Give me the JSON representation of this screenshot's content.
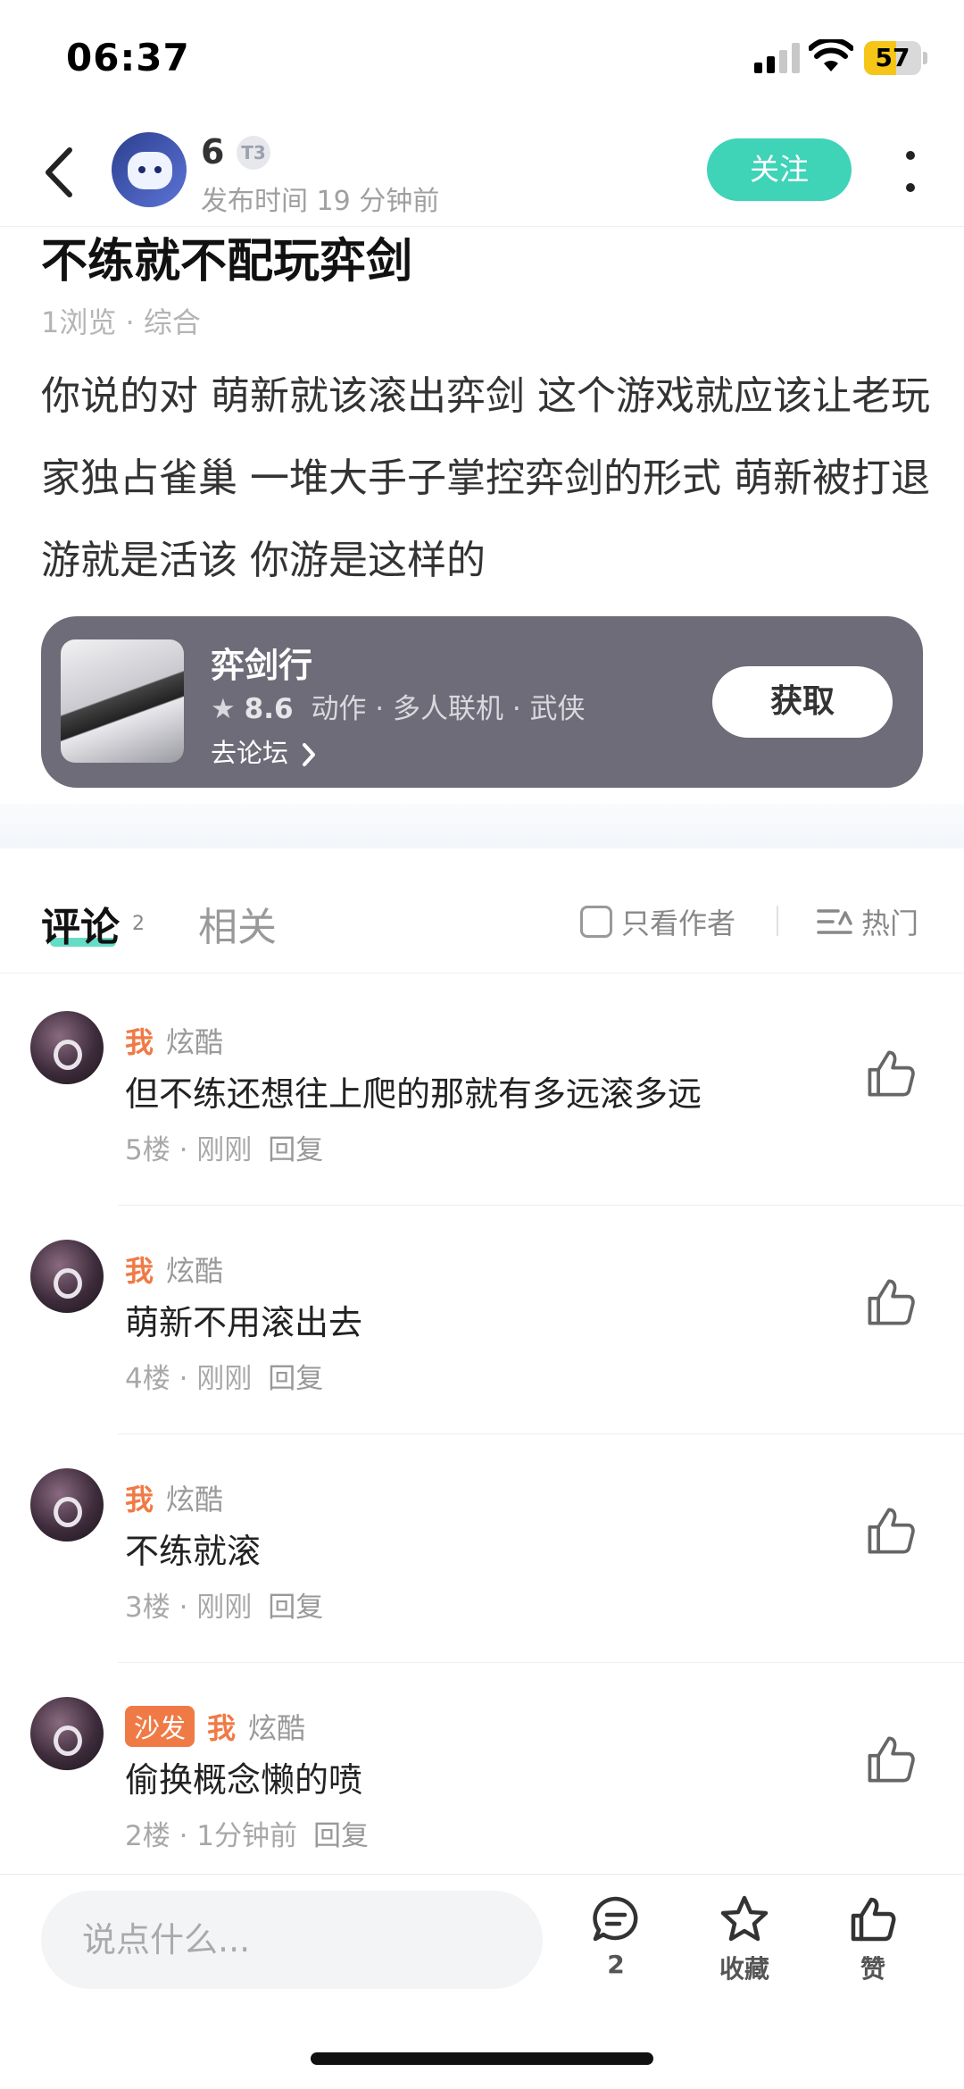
{
  "status_bar": {
    "time": "06:37",
    "battery": "57",
    "battery_level": 0.57
  },
  "header": {
    "author_name": "6",
    "level_badge": "T3",
    "publish_time": "发布时间 19 分钟前",
    "follow_label": "关注"
  },
  "post": {
    "title": "不练就不配玩弈剑",
    "meta": "1浏览 · 综合",
    "body": "你说的对 萌新就该滚出弈剑 这个游戏就应该让老玩家独占雀巢 一堆大手子掌控弈剑的形式 萌新被打退游就是活该 你游是这样的"
  },
  "game_card": {
    "name": "弈剑行",
    "rating": "8.6",
    "tags": "动作 · 多人联机 · 武侠",
    "forum_link": "去论坛",
    "get_label": "获取"
  },
  "tabs": {
    "comments_label": "评论",
    "comments_count": "2",
    "related_label": "相关",
    "author_only_label": "只看作者",
    "sort_label": "热门"
  },
  "comments": [
    {
      "tag": "",
      "me": "我",
      "user": "炫酷",
      "text": "但不练还想往上爬的那就有多远滚多远",
      "meta": "5楼 · 刚刚",
      "reply": "回复"
    },
    {
      "tag": "",
      "me": "我",
      "user": "炫酷",
      "text": "萌新不用滚出去",
      "meta": "4楼 · 刚刚",
      "reply": "回复"
    },
    {
      "tag": "",
      "me": "我",
      "user": "炫酷",
      "text": "不练就滚",
      "meta": "3楼 · 刚刚",
      "reply": "回复"
    },
    {
      "tag": "沙发",
      "me": "我",
      "user": "炫酷",
      "text": "偷换概念懒的喷",
      "meta": "2楼 · 1分钟前",
      "reply": "回复"
    }
  ],
  "bottom_bar": {
    "input_placeholder": "说点什么...",
    "comment_count": "2",
    "favorite_label": "收藏",
    "like_label": "赞"
  },
  "colors": {
    "accent": "#3fd3b8",
    "orange": "#f07a45",
    "card": "#6e6c78"
  },
  "icons": [
    "back-icon",
    "more-icon",
    "star-icon",
    "chevron-right-icon",
    "checkbox-icon",
    "sort-icon",
    "thumbs-up-icon",
    "comment-icon",
    "favorite-star-icon",
    "wifi-icon",
    "signal-icon"
  ]
}
